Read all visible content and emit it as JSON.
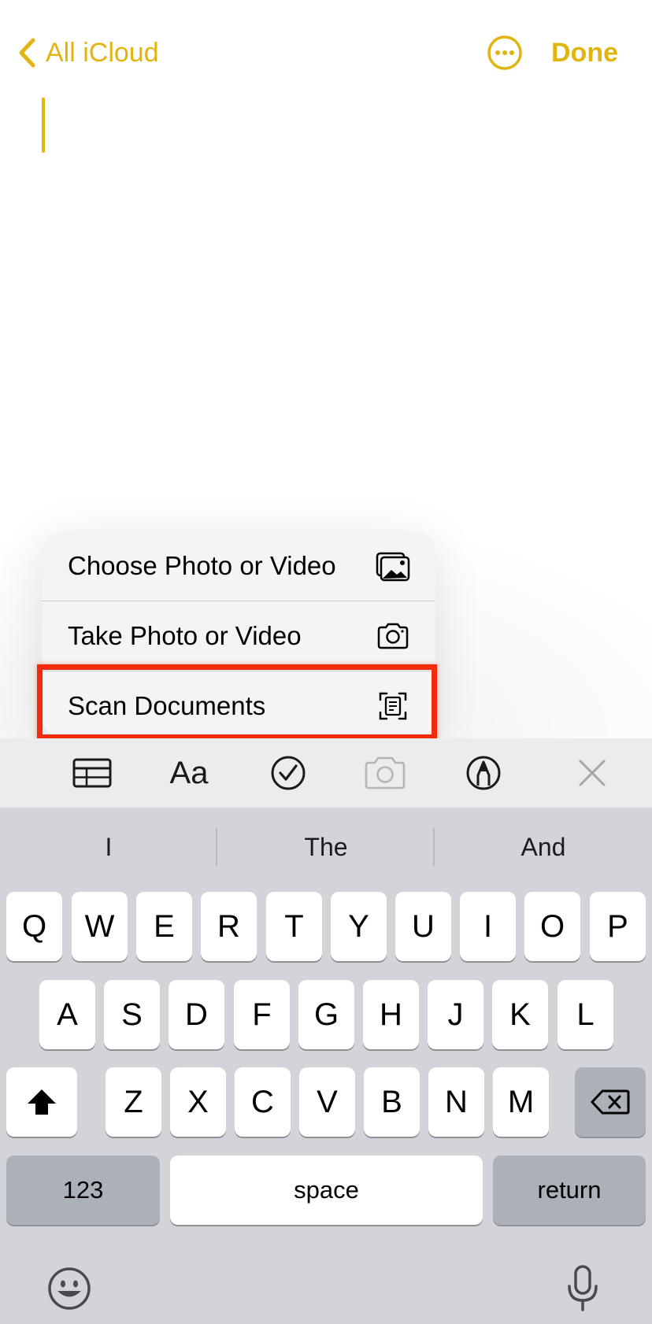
{
  "nav": {
    "back_label": "All iCloud",
    "done_label": "Done",
    "accent_color": "#E2B40F"
  },
  "menu": {
    "items": [
      {
        "label": "Choose Photo or Video",
        "icon": "photo-library-icon"
      },
      {
        "label": "Take Photo or Video",
        "icon": "camera-icon"
      },
      {
        "label": "Scan Documents",
        "icon": "document-scan-icon"
      }
    ],
    "highlight_color": "#F22A0E"
  },
  "toolbar": {
    "format_label": "Aa",
    "tools": [
      "table-icon",
      "format-text",
      "checklist-icon",
      "camera-icon",
      "markup-icon",
      "close-icon"
    ]
  },
  "keyboard": {
    "suggestions": [
      "I",
      "The",
      "And"
    ],
    "row1": [
      "Q",
      "W",
      "E",
      "R",
      "T",
      "Y",
      "U",
      "I",
      "O",
      "P"
    ],
    "row2": [
      "A",
      "S",
      "D",
      "F",
      "G",
      "H",
      "J",
      "K",
      "L"
    ],
    "row3": [
      "Z",
      "X",
      "C",
      "V",
      "B",
      "N",
      "M"
    ],
    "numbers_label": "123",
    "space_label": "space",
    "return_label": "return"
  }
}
